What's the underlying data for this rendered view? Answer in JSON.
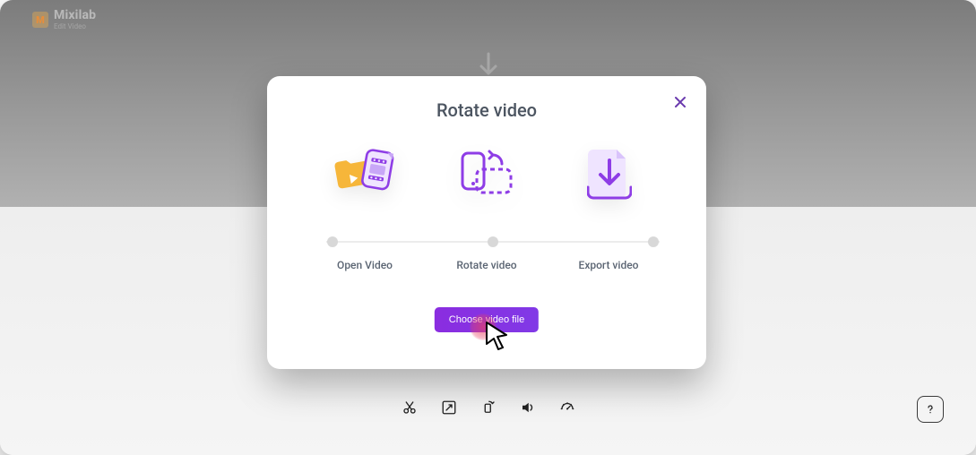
{
  "brand": {
    "name": "Mixilab",
    "sub": "Edit Video"
  },
  "modal": {
    "title": "Rotate video",
    "steps": [
      {
        "label": "Open Video"
      },
      {
        "label": "Rotate video"
      },
      {
        "label": "Export video"
      }
    ],
    "cta_label": "Choose video file"
  },
  "toolbar": {
    "items": [
      "cut",
      "resize",
      "rotate",
      "volume",
      "speed"
    ]
  }
}
